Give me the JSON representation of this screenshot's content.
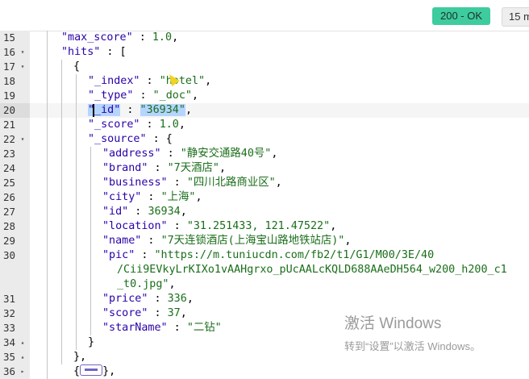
{
  "response": {
    "status": "200 - OK",
    "time": "15 m"
  },
  "editor": {
    "lines": [
      {
        "num": "15",
        "fold": "",
        "tokens": [
          [
            "k",
            "\"max_score\""
          ],
          [
            "p",
            " : "
          ],
          [
            "n",
            "1.0"
          ],
          [
            "p",
            ","
          ]
        ]
      },
      {
        "num": "16",
        "fold": "▾",
        "tokens": [
          [
            "k",
            "\"hits\""
          ],
          [
            "p",
            " : ["
          ]
        ]
      },
      {
        "num": "17",
        "fold": "▾",
        "tokens": [
          [
            "p",
            "{"
          ]
        ]
      },
      {
        "num": "18",
        "fold": "",
        "tokens": [
          [
            "k",
            "\"_index\""
          ],
          [
            "p",
            " : "
          ],
          [
            "s",
            "\"hotel\""
          ],
          [
            "p",
            ","
          ]
        ]
      },
      {
        "num": "19",
        "fold": "",
        "tokens": [
          [
            "k",
            "\"_type\""
          ],
          [
            "p",
            " : "
          ],
          [
            "s",
            "\"_doc\""
          ],
          [
            "p",
            ","
          ]
        ]
      },
      {
        "num": "20",
        "fold": "",
        "tokens": [
          [
            "k",
            "\"_id\""
          ],
          [
            "p",
            " : "
          ],
          [
            "s",
            "\"36934\""
          ],
          [
            "p",
            ","
          ]
        ]
      },
      {
        "num": "21",
        "fold": "",
        "tokens": [
          [
            "k",
            "\"_score\""
          ],
          [
            "p",
            " : "
          ],
          [
            "n",
            "1.0"
          ],
          [
            "p",
            ","
          ]
        ]
      },
      {
        "num": "22",
        "fold": "▾",
        "tokens": [
          [
            "k",
            "\"_source\""
          ],
          [
            "p",
            " : {"
          ]
        ]
      },
      {
        "num": "23",
        "fold": "",
        "tokens": [
          [
            "k",
            "\"address\""
          ],
          [
            "p",
            " : "
          ],
          [
            "s",
            "\"静安交通路40号\""
          ],
          [
            "p",
            ","
          ]
        ]
      },
      {
        "num": "24",
        "fold": "",
        "tokens": [
          [
            "k",
            "\"brand\""
          ],
          [
            "p",
            " : "
          ],
          [
            "s",
            "\"7天酒店\""
          ],
          [
            "p",
            ","
          ]
        ]
      },
      {
        "num": "25",
        "fold": "",
        "tokens": [
          [
            "k",
            "\"business\""
          ],
          [
            "p",
            " : "
          ],
          [
            "s",
            "\"四川北路商业区\""
          ],
          [
            "p",
            ","
          ]
        ]
      },
      {
        "num": "26",
        "fold": "",
        "tokens": [
          [
            "k",
            "\"city\""
          ],
          [
            "p",
            " : "
          ],
          [
            "s",
            "\"上海\""
          ],
          [
            "p",
            ","
          ]
        ]
      },
      {
        "num": "27",
        "fold": "",
        "tokens": [
          [
            "k",
            "\"id\""
          ],
          [
            "p",
            " : "
          ],
          [
            "n",
            "36934"
          ],
          [
            "p",
            ","
          ]
        ]
      },
      {
        "num": "28",
        "fold": "",
        "tokens": [
          [
            "k",
            "\"location\""
          ],
          [
            "p",
            " : "
          ],
          [
            "s",
            "\"31.251433, 121.47522\""
          ],
          [
            "p",
            ","
          ]
        ]
      },
      {
        "num": "29",
        "fold": "",
        "tokens": [
          [
            "k",
            "\"name\""
          ],
          [
            "p",
            " : "
          ],
          [
            "s",
            "\"7天连锁酒店(上海宝山路地铁站店)\""
          ],
          [
            "p",
            ","
          ]
        ]
      },
      {
        "num": "30",
        "fold": "",
        "tokens": [
          [
            "k",
            "\"pic\""
          ],
          [
            "p",
            " : "
          ],
          [
            "s",
            "\"https://m.tuniucdn.com/fb2/t1/G1/M00/3E/40"
          ]
        ]
      },
      {
        "num": "",
        "fold": "",
        "tokens": [
          [
            "s",
            "/Cii9EVkyLrKIXo1vAAHgrxo_pUcAALcKQLD688AAeDH564_w200_h200_c1"
          ]
        ]
      },
      {
        "num": "",
        "fold": "",
        "tokens": [
          [
            "s",
            "_t0.jpg\""
          ],
          [
            "p",
            ","
          ]
        ]
      },
      {
        "num": "31",
        "fold": "",
        "tokens": [
          [
            "k",
            "\"price\""
          ],
          [
            "p",
            " : "
          ],
          [
            "n",
            "336"
          ],
          [
            "p",
            ","
          ]
        ]
      },
      {
        "num": "32",
        "fold": "",
        "tokens": [
          [
            "k",
            "\"score\""
          ],
          [
            "p",
            " : "
          ],
          [
            "n",
            "37"
          ],
          [
            "p",
            ","
          ]
        ]
      },
      {
        "num": "33",
        "fold": "",
        "tokens": [
          [
            "k",
            "\"starName\""
          ],
          [
            "p",
            " : "
          ],
          [
            "s",
            "\"二钻\""
          ]
        ]
      },
      {
        "num": "34",
        "fold": "▴",
        "tokens": [
          [
            "p",
            "}"
          ]
        ]
      },
      {
        "num": "35",
        "fold": "▴",
        "tokens": [
          [
            "p",
            "},"
          ]
        ]
      },
      {
        "num": "36",
        "fold": "▸",
        "tokens": [
          [
            "p",
            "{"
          ],
          [
            "collapsed",
            ""
          ],
          [
            "p",
            "},"
          ]
        ]
      }
    ]
  },
  "watermark": {
    "title": "激活 Windows",
    "subtitle": "转到“设置”以激活 Windows。"
  }
}
